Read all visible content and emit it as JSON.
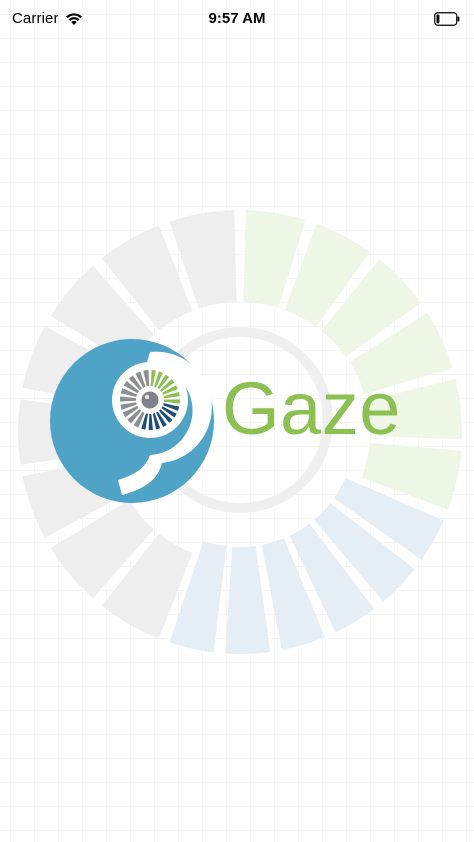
{
  "status_bar": {
    "carrier": "Carrier",
    "time": "9:57 AM",
    "wifi_icon": "wifi-icon",
    "battery_icon": "battery-icon",
    "battery_level": 0.15
  },
  "splash": {
    "brand_name": "Gaze",
    "logo_icon": "eye-spiral-logo-icon",
    "colors": {
      "brand_blue": "#4fa3c7",
      "brand_green": "#8cc152",
      "brand_navy": "#1f4e79",
      "brand_gray": "#8a8f94",
      "background_watermark_blue": "#e6eef5",
      "background_watermark_gray": "#eeeeee",
      "background_watermark_green": "#eef6e6"
    }
  }
}
